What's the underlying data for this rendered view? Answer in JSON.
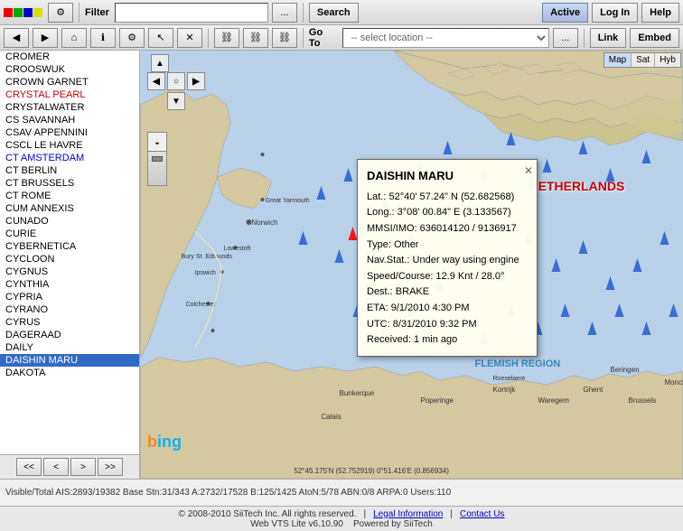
{
  "toolbar1": {
    "filter_label": "Filter",
    "filter_placeholder": "",
    "search_btn": "Search",
    "active_btn": "Active",
    "login_btn": "Log In",
    "help_btn": "Help",
    "dots_btn": "..."
  },
  "toolbar2": {
    "goto_label": "Go To",
    "location_placeholder": "-- select location --",
    "dots_btn": "...",
    "link_btn": "Link",
    "embed_btn": "Embed"
  },
  "vessel_list": {
    "items": [
      {
        "name": "CROMER",
        "style": "normal"
      },
      {
        "name": "CROOSWUK",
        "style": "normal"
      },
      {
        "name": "CROWN GARNET",
        "style": "normal"
      },
      {
        "name": "CRYSTAL PEARL",
        "style": "red"
      },
      {
        "name": "CRYSTALWATER",
        "style": "normal"
      },
      {
        "name": "CS SAVANNAH",
        "style": "normal"
      },
      {
        "name": "CSAV APPENNINI",
        "style": "normal"
      },
      {
        "name": "CSCL LE HAVRE",
        "style": "normal"
      },
      {
        "name": "CT AMSTERDAM",
        "style": "blue"
      },
      {
        "name": "CT BERLIN",
        "style": "normal"
      },
      {
        "name": "CT BRUSSELS",
        "style": "normal"
      },
      {
        "name": "CT ROME",
        "style": "normal"
      },
      {
        "name": "CUM ANNEXIS",
        "style": "normal"
      },
      {
        "name": "CUNADO",
        "style": "normal"
      },
      {
        "name": "CURIE",
        "style": "normal"
      },
      {
        "name": "CYBERNETICA",
        "style": "normal"
      },
      {
        "name": "CYCLOON",
        "style": "normal"
      },
      {
        "name": "CYGNUS",
        "style": "normal"
      },
      {
        "name": "CYNTHIA",
        "style": "normal"
      },
      {
        "name": "CYPRIA",
        "style": "normal"
      },
      {
        "name": "CYRANO",
        "style": "normal"
      },
      {
        "name": "CYRUS",
        "style": "normal"
      },
      {
        "name": "DAGERAAD",
        "style": "normal"
      },
      {
        "name": "DAILY",
        "style": "normal"
      },
      {
        "name": "DAISHIN MARU",
        "style": "selected"
      },
      {
        "name": "DAKOTA",
        "style": "normal"
      }
    ],
    "nav_buttons": [
      "<<",
      "<",
      ">",
      ">>"
    ]
  },
  "vessel_popup": {
    "name": "DAISHIN MARU",
    "lat": "Lat.: 52°40' 57.24\" N (52.682568)",
    "lon": "Long.: 3°08' 00.84\" E (3.133567)",
    "mmsi": "MMSI/IMO: 636014120 / 9136917",
    "type": "Type: Other",
    "navstat": "Nav.Stat.: Under way using engine",
    "speed": "Speed/Course: 12.9 Knt / 28.0°",
    "dest": "Dest.: BRAKE",
    "eta": "ETA: 9/1/2010 4:30 PM",
    "utc": "UTC: 8/31/2010 9:32 PM",
    "received": "Received: 1 min ago"
  },
  "map": {
    "type_buttons": [
      "Map",
      "Sat",
      "Hyb"
    ],
    "active_type": "Map",
    "zoom_in": "+",
    "zoom_out": "-",
    "country_label": "NETHERLANDS"
  },
  "status_bar": {
    "text": "Visible/Total AIS:2893/19382  Base Stn:31/343  A:2732/17528  B:125/1425  AtoN:5/78  ABN:0/8  ARPA:0  Users:110"
  },
  "footer": {
    "copyright": "© 2008-2010 SiiTech Inc. All rights reserved.",
    "legal_link": "Legal Information",
    "contact_link": "Contact Us",
    "version": "Web VTS Lite v6.10.90",
    "powered": "Powered by SiiTech"
  }
}
